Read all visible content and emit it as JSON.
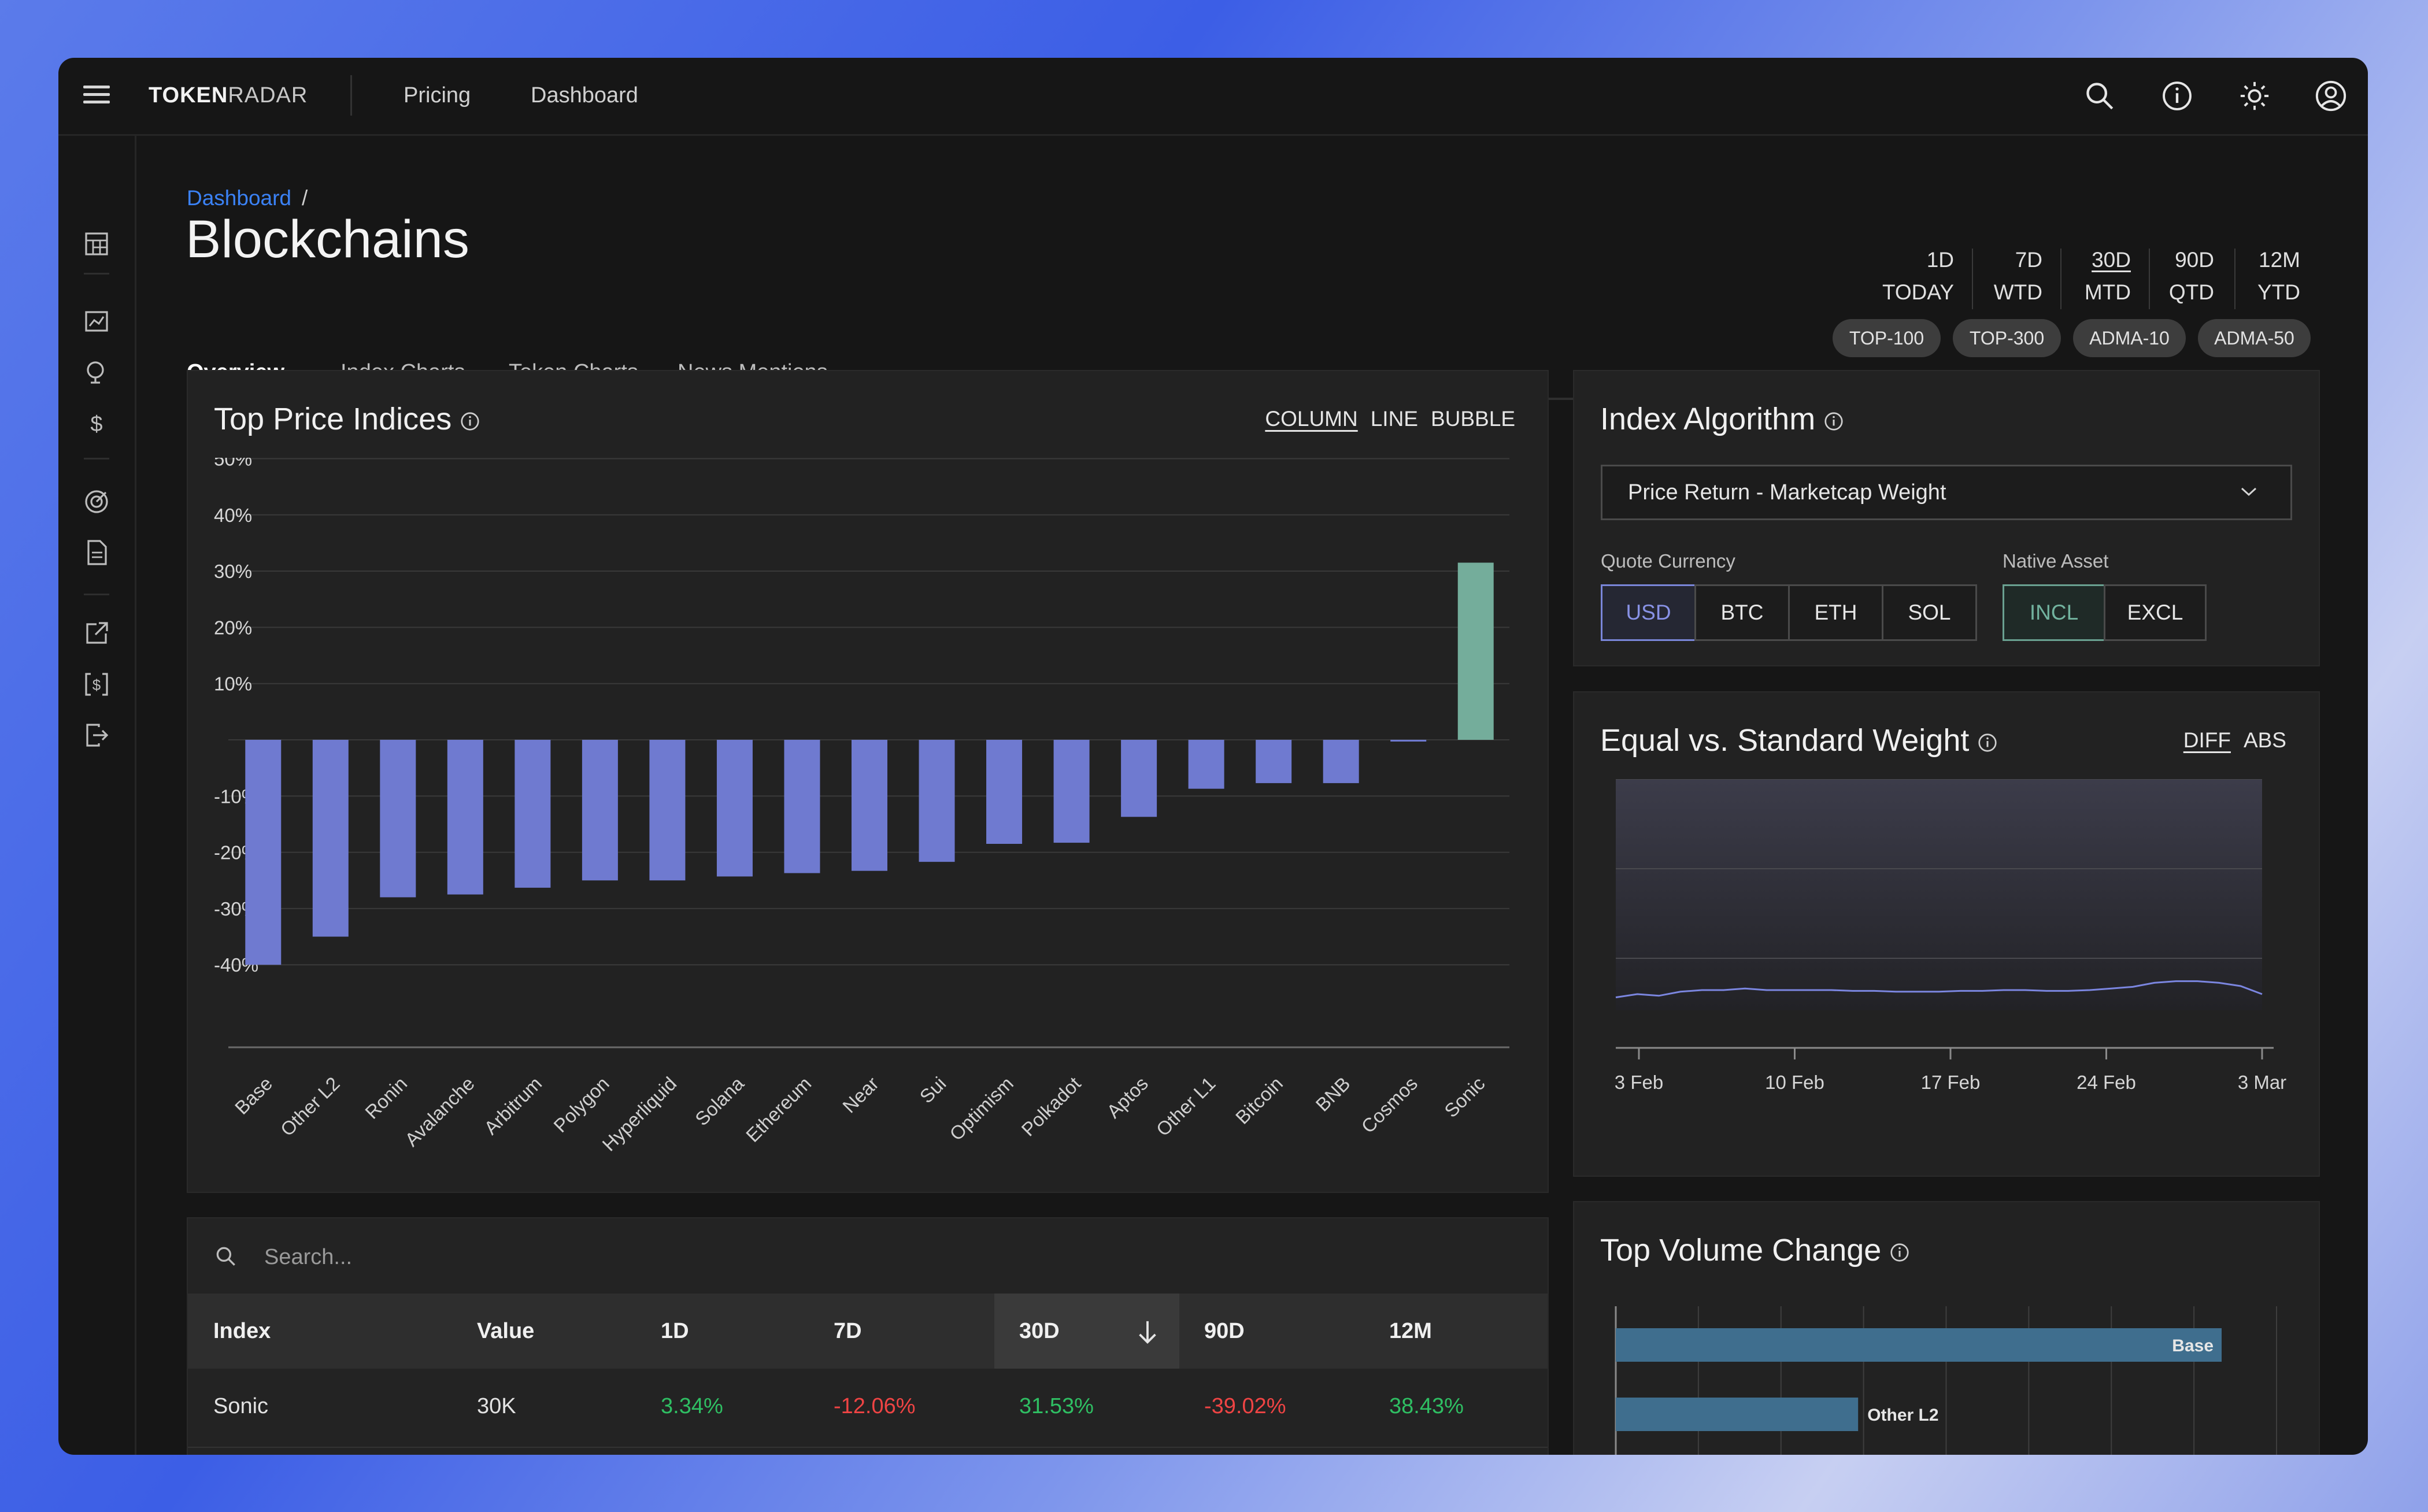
{
  "brand": {
    "bold": "TOKEN",
    "regular": "RADAR"
  },
  "top_nav": [
    "Pricing",
    "Dashboard"
  ],
  "breadcrumb": {
    "link": "Dashboard",
    "separator": "/"
  },
  "page_title": "Blockchains",
  "tabs": [
    "Overview",
    "Index Charts",
    "Token Charts",
    "News Mentions"
  ],
  "active_tab": "Overview",
  "periods": [
    {
      "top": "1D",
      "bottom": "TODAY",
      "selected": false
    },
    {
      "top": "7D",
      "bottom": "WTD",
      "selected": false
    },
    {
      "top": "30D",
      "bottom": "MTD",
      "selected": true
    },
    {
      "top": "90D",
      "bottom": "QTD",
      "selected": false
    },
    {
      "top": "12M",
      "bottom": "YTD",
      "selected": false
    }
  ],
  "pills": [
    "TOP-100",
    "TOP-300",
    "ADMA-10",
    "ADMA-50"
  ],
  "price_panel": {
    "title": "Top Price Indices",
    "views": [
      "COLUMN",
      "LINE",
      "BUBBLE"
    ],
    "selected_view": "COLUMN"
  },
  "chart_data": [
    {
      "type": "bar",
      "categories": [
        "Base",
        "Other L2",
        "Ronin",
        "Avalanche",
        "Arbitrum",
        "Polygon",
        "Hyperliquid",
        "Solana",
        "Ethereum",
        "Near",
        "Sui",
        "Optimism",
        "Polkadot",
        "Aptos",
        "Other L1",
        "Bitcoin",
        "BNB",
        "Cosmos",
        "Sonic"
      ],
      "values": [
        -40,
        -35,
        -28,
        -27.5,
        -26.3,
        -25,
        -25,
        -24.3,
        -23.7,
        -23.3,
        -21.7,
        -18.5,
        -18.3,
        -13.7,
        -8.7,
        -7.7,
        -7.7,
        -0.3,
        31.5
      ],
      "ylim": [
        -50,
        50
      ],
      "yticks": [
        "50%",
        "40%",
        "30%",
        "20%",
        "10%",
        "-10%",
        "-20%",
        "-30%",
        "-40%"
      ],
      "colors": {
        "negative": "#6f7ad0",
        "positive": "#74ad9b"
      },
      "grid": true
    },
    {
      "type": "line",
      "x": [
        "3 Feb",
        "4 Feb",
        "5 Feb",
        "6 Feb",
        "7 Feb",
        "8 Feb",
        "9 Feb",
        "10 Feb",
        "11 Feb",
        "12 Feb",
        "13 Feb",
        "14 Feb",
        "15 Feb",
        "16 Feb",
        "17 Feb",
        "18 Feb",
        "19 Feb",
        "20 Feb",
        "21 Feb",
        "22 Feb",
        "23 Feb",
        "24 Feb",
        "25 Feb",
        "26 Feb",
        "27 Feb",
        "28 Feb",
        "1 Mar",
        "2 Mar",
        "3 Mar"
      ],
      "values": [
        -2,
        0,
        -1,
        1.5,
        2.5,
        2.5,
        3.5,
        2.5,
        2.5,
        2.5,
        2.5,
        2,
        2,
        1.5,
        1.5,
        1.5,
        2,
        2,
        2.5,
        2.5,
        2,
        2,
        2.5,
        3.5,
        4.5,
        7,
        8,
        8,
        7,
        5,
        0
      ],
      "ylim": [
        -10,
        50
      ],
      "xticks": [
        "3 Feb",
        "10 Feb",
        "17 Feb",
        "24 Feb",
        "3 Mar"
      ],
      "colors": {
        "line": "#7b86e0"
      },
      "grid": true
    },
    {
      "type": "bar",
      "orientation": "horizontal",
      "categories": [
        "Base",
        "Other L2"
      ],
      "values": [
        100,
        40
      ],
      "colors": {
        "bar": "#3f6e8e"
      }
    }
  ],
  "algorithm_panel": {
    "title": "Index Algorithm",
    "select_value": "Price Return - Marketcap Weight",
    "quote_label": "Quote Currency",
    "quote_options": [
      "USD",
      "BTC",
      "ETH",
      "SOL"
    ],
    "quote_selected": "USD",
    "native_label": "Native Asset",
    "native_options": [
      "INCL",
      "EXCL"
    ],
    "native_selected": "INCL"
  },
  "weight_panel": {
    "title": "Equal vs. Standard Weight",
    "views": [
      "DIFF",
      "ABS"
    ],
    "selected_view": "DIFF"
  },
  "volume_panel": {
    "title": "Top Volume Change"
  },
  "table": {
    "search_placeholder": "Search...",
    "columns": [
      "Index",
      "Value",
      "1D",
      "7D",
      "30D",
      "90D",
      "12M"
    ],
    "sorted_column": "30D",
    "rows": [
      {
        "index": "Sonic",
        "value": "30K",
        "d1": "3.34%",
        "d7": "-12.06%",
        "d30": "31.53%",
        "d90": "-39.02%",
        "m12": "38.43%"
      }
    ]
  }
}
